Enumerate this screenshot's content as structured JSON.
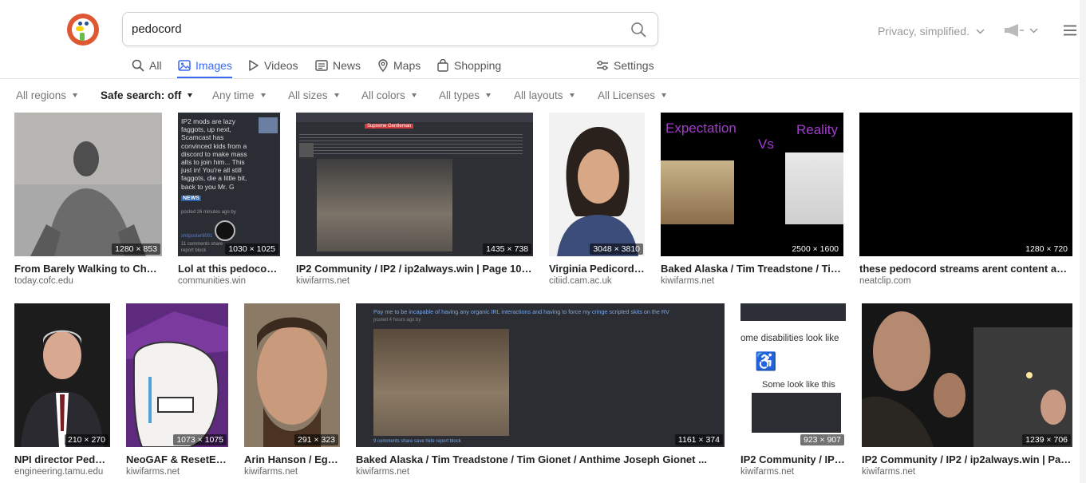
{
  "search": {
    "query": "pedocord"
  },
  "header": {
    "privacy_label": "Privacy, simplified."
  },
  "tabs": [
    {
      "label": "All",
      "icon": "search-icon"
    },
    {
      "label": "Images",
      "icon": "image-icon",
      "active": true
    },
    {
      "label": "Videos",
      "icon": "play-icon"
    },
    {
      "label": "News",
      "icon": "newspaper-icon"
    },
    {
      "label": "Maps",
      "icon": "map-pin-icon"
    },
    {
      "label": "Shopping",
      "icon": "shopping-bag-icon"
    },
    {
      "label": "Settings",
      "icon": "settings-sliders-icon"
    }
  ],
  "filters": [
    {
      "label": "All regions"
    },
    {
      "label": "Safe search: off",
      "bold": true
    },
    {
      "label": "Any time"
    },
    {
      "label": "All sizes"
    },
    {
      "label": "All colors"
    },
    {
      "label": "All types"
    },
    {
      "label": "All layouts"
    },
    {
      "label": "All Licenses"
    }
  ],
  "row1": [
    {
      "title": "From Barely Walking to Cham...",
      "source": "today.cofc.edu",
      "dims": "1280 × 853"
    },
    {
      "title": "Lol at this pedocord...",
      "source": "communities.win",
      "dims": "1030 × 1025",
      "lines": [
        "IP2 mods are lazy",
        "faggots, up next,",
        "Scamcast has",
        "convinced kids from a",
        "discord to make mass",
        "alts to join him... This",
        "just in! You're all still",
        "faggots, die a little bit,",
        "back to you Mr. G"
      ],
      "badge": "NEWS",
      "posted": "posted 26 minutes ago by",
      "user": "shitposter9001",
      "comments": "11 comments  share",
      "actions": "report  block"
    },
    {
      "title": "IP2 Community / IP2 / ip2always.win | Page 100 | ...",
      "source": "kiwifarms.net",
      "dims": "1435 × 738",
      "tag": "Supreme Gentleman"
    },
    {
      "title": "Virginia Pedicord -...",
      "source": "citiid.cam.ac.uk",
      "dims": "3048 × 3810"
    },
    {
      "title": "Baked Alaska / Tim Treadstone / Tim ...",
      "source": "kiwifarms.net",
      "dims": "2500 × 1600",
      "meme_left": "Expectation",
      "meme_mid": "Vs",
      "meme_right": "Reality"
    },
    {
      "title": "these pedocord streams arent content and ...",
      "source": "neatclip.com",
      "dims": "1280 × 720"
    }
  ],
  "row2": [
    {
      "title": "NPI director Peddi...",
      "source": "engineering.tamu.edu",
      "dims": "210 × 270"
    },
    {
      "title": "NeoGAF & ResetER...",
      "source": "kiwifarms.net",
      "dims": "1073 × 1075"
    },
    {
      "title": "Arin Hanson / Ego...",
      "source": "kiwifarms.net",
      "dims": "291 × 323"
    },
    {
      "title": "Baked Alaska / Tim Treadstone / Tim Gionet / Anthime Joseph Gionet ...",
      "source": "kiwifarms.net",
      "dims": "1161 × 374",
      "caption": "Pay me to be incapable of having any organic IRL interactions and having to force my cringe scripted skits on the RV",
      "posted": "posted 4 hours ago by",
      "comments": "9 comments  share  save  hide  report  block"
    },
    {
      "title": "IP2 Community / IP2...",
      "source": "kiwifarms.net",
      "dims": "923 × 907",
      "line1": "ome disabilities look like",
      "line2": "Some look like this"
    },
    {
      "title": "IP2 Community / IP2 / ip2always.win | Page...",
      "source": "kiwifarms.net",
      "dims": "1239 × 706"
    }
  ],
  "colors": {
    "accent": "#3969ef",
    "logo": "#de5833"
  }
}
